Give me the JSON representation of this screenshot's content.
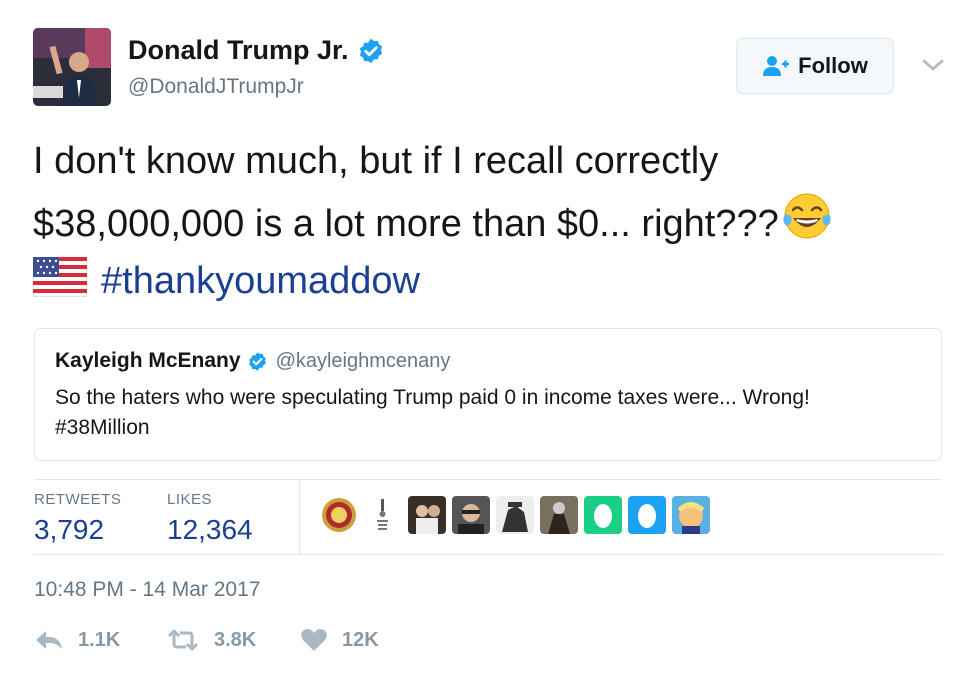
{
  "author": {
    "name": "Donald Trump Jr.",
    "handle": "@DonaldJTrumpJr",
    "avatar_icon": "profile-photo",
    "verified_icon": "verified-badge-icon"
  },
  "follow_button": {
    "label": "Follow",
    "icon": "add-person-icon"
  },
  "tweet": {
    "line1": "I don't know much, but if I recall correctly",
    "line2": "$38,000,000 is a lot more than $0... right???",
    "emoji": "tears-of-joy-emoji",
    "flag": "us-flag-emoji",
    "hashtag": "#thankyoumaddow"
  },
  "quoted_tweet": {
    "name": "Kayleigh McEnany",
    "handle": "@kayleighmcenany",
    "text_line1": "So the haters who were speculating Trump paid 0 in income taxes were... Wrong!",
    "text_line2": "#38Million"
  },
  "stats": {
    "retweets_label": "RETWEETS",
    "retweets_value": "3,792",
    "likes_label": "LIKES",
    "likes_value": "12,364"
  },
  "timestamp": "10:48 PM - 14 Mar 2017",
  "actions": {
    "reply_count": "1.1K",
    "retweet_count": "3.8K",
    "like_count": "12K"
  },
  "colors": {
    "link": "#1b3f93",
    "verified": "#1da1f2",
    "muted": "#657786",
    "border": "#e1e8ed"
  }
}
